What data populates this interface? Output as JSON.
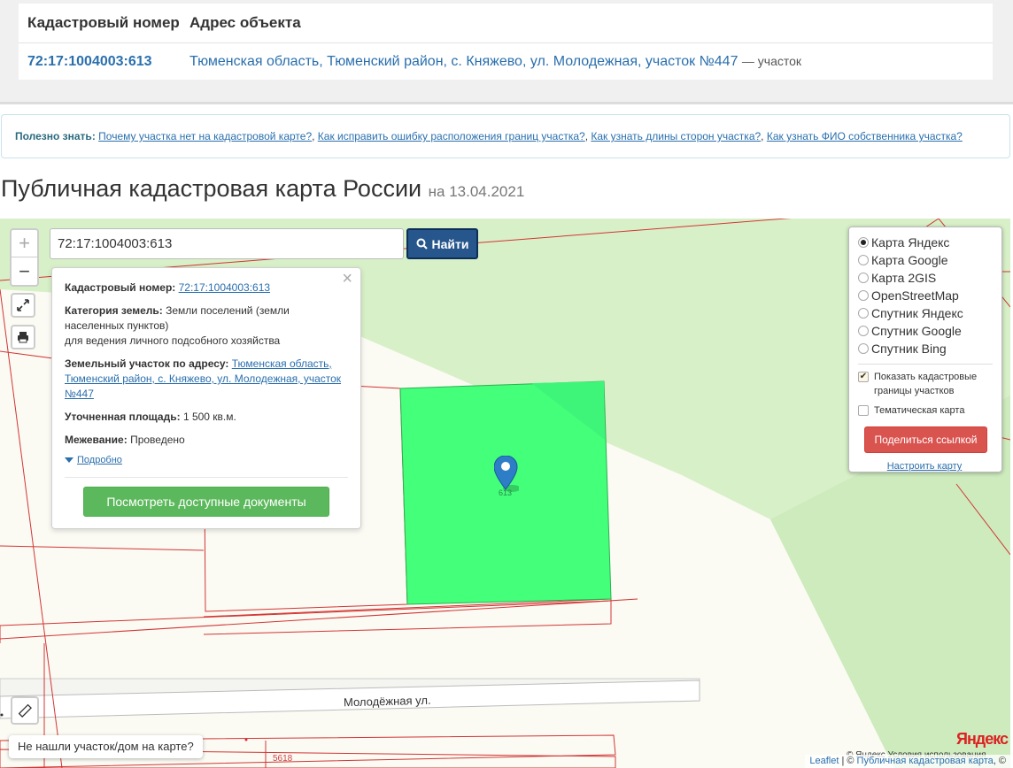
{
  "results": {
    "headers": [
      "Кадастровый номер",
      "Адрес объекта"
    ],
    "row": {
      "cadastral": "72:17:1004003:613",
      "address": "Тюменская область, Тюменский район, с. Княжево, ул. Молодежная, участок №447",
      "kind": "— участок"
    }
  },
  "infobar": {
    "label": "Полезно знать:",
    "links": [
      "Почему участка нет на кадастровой карте?",
      "Как исправить ошибку расположения границ участка?",
      "Как узнать длины сторон участка?",
      "Как узнать ФИО собственника участка?"
    ]
  },
  "heading": {
    "title": "Публичная кадастровая карта России",
    "date": "на 13.04.2021"
  },
  "map": {
    "zoom_in": "+",
    "zoom_out": "−",
    "search_value": "72:17:1004003:613",
    "find_label": "Найти",
    "street_label": "Молодёжная ул.",
    "lot_number": "5618",
    "not_found": "Не нашли участок/дом на карте?",
    "yandex_logo": "Яндекс",
    "terms": "© Яндекс Условия использования",
    "attrib_leaflet": "Leaflet",
    "attrib_pkk": "Публичная кадастровая карта",
    "attrib_tail": ", ©",
    "parcel_label": "613"
  },
  "popup": {
    "cad_label": "Кадастровый номер:",
    "cad_value": "72:17:1004003:613",
    "cat_label": "Категория земель:",
    "cat_value": "Земли поселений (земли населенных пунктов)",
    "cat_use": "для ведения личного подсобного хозяйства",
    "addr_label": "Земельный участок по адресу:",
    "addr_value": "Тюменская область, Тюменский район, с. Княжево, ул. Молодежная, участок №447",
    "area_label": "Уточненная площадь:",
    "area_value": "1 500 кв.м.",
    "survey_label": "Межевание:",
    "survey_value": "Проведено",
    "more_label": "Подробно",
    "docs_button": "Посмотреть доступные документы",
    "close": "×"
  },
  "layers": {
    "options": [
      "Карта Яндекс",
      "Карта Google",
      "Карта 2GIS",
      "OpenStreetMap",
      "Спутник Яндекс",
      "Спутник Google",
      "Спутник Bing"
    ],
    "selected": "Карта Яндекс",
    "show_borders": "Показать кадастровые границы участков",
    "thematic": "Тематическая карта",
    "share_button": "Поделиться ссылкой",
    "tune_link": "Настроить карту"
  },
  "colors": {
    "accent": "#2a6fad",
    "parcel": "#43ff7a",
    "border": "#d33434",
    "share": "#d9534f",
    "docs": "#5cb85c",
    "find": "#26568c"
  }
}
